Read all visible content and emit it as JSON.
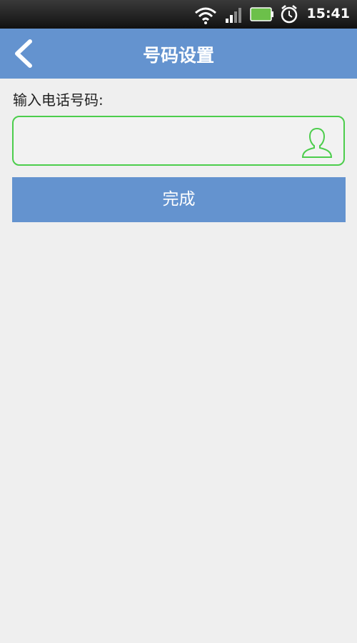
{
  "status_bar": {
    "time": "15:41",
    "icons": [
      "wifi-icon",
      "signal-icon",
      "battery-icon",
      "alarm-icon"
    ],
    "battery_color": "#6cc04a"
  },
  "header": {
    "title": "号码设置",
    "back_icon": "chevron-left-icon",
    "background": "#6493cf"
  },
  "form": {
    "phone_label": "输入电话号码:",
    "phone_value": "",
    "phone_placeholder": "",
    "contact_icon": "contact-person-icon",
    "field_border_color": "#4ccd4c"
  },
  "actions": {
    "done_label": "完成",
    "done_color": "#6493cf"
  }
}
